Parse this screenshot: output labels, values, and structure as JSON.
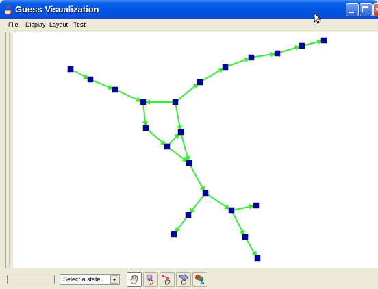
{
  "window": {
    "title": "Guess Visualization",
    "icon": "java-cup-icon"
  },
  "menu": [
    "File",
    "Display",
    "Layout",
    "Test"
  ],
  "graph": {
    "node_color": "#0000AA",
    "edge_color": "#33EE33",
    "background": "#FFFFFF"
  },
  "toolbar": {
    "status_text": "",
    "state_select": {
      "value": "Select a state"
    },
    "tools": [
      {
        "name": "hand-browse-tool-icon",
        "active": true
      },
      {
        "name": "node-edit-tool-icon",
        "active": false
      },
      {
        "name": "edge-edit-tool-icon",
        "active": false
      },
      {
        "name": "hull-tool-icon",
        "active": false
      },
      {
        "name": "label-tool-icon",
        "active": false
      }
    ]
  }
}
